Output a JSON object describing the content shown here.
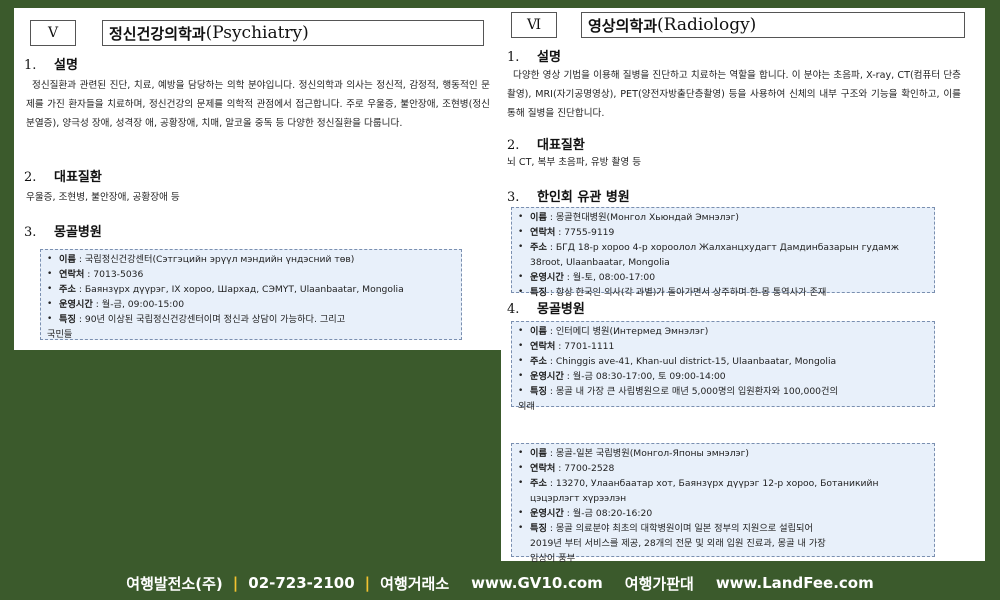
{
  "left": {
    "chapter_num": "Ⅴ",
    "chapter_title_ko": "정신건강의학과",
    "chapter_title_en": "(Psychiatry)",
    "s1": {
      "num": "1.",
      "title": "설명",
      "text": "정신질환과 관련된 진단, 치료, 예방을 담당하는 의학 분야입니다. 정신의학과 의사는 정신적, 감정적, 행동적인 문제를 가진 환자들을 치료하며, 정신건강의 문제를 의학적 관점에서 접근합니다. 주로 우울증, 불안장애, 조현병(정신분열증), 양극성 장애, 성격장 애, 공황장애, 치매, 알코올 중독 등 다양한 정신질환을 다룹니다."
    },
    "s2": {
      "num": "2.",
      "title": "대표질환",
      "text": "우울증, 조현병, 불안장애, 공황장애 등"
    },
    "s3": {
      "num": "3.",
      "title": "몽골병원"
    },
    "hospital": {
      "name_label": "이름",
      "name": "국립정신건강센터(Сэтгэцийн эрүүл мэндийн үндэсний төв)",
      "phone_label": "연락처",
      "phone": "7013-5036",
      "addr_label": "주소",
      "addr": "Баянзүрх дүүрэг, IX хороо, Шархад, СЭМҮТ, Ulaanbaatar, Mongolia",
      "hours_label": "운영시간",
      "hours": "월-금, 09:00-15:00",
      "feat_label": "특징",
      "feat": "90년 이상된 국립정신건강센터이며 정신과 상담이 가능하다. 그리고",
      "feat_cont": "국민들"
    }
  },
  "right": {
    "chapter_num": "Ⅵ",
    "chapter_title_ko": "영상의학과",
    "chapter_title_en": "(Radiology)",
    "s1": {
      "num": "1.",
      "title": "설명",
      "text": "다양한 영상 기법을 이용해 질병을 진단하고 치료하는 역할을 합니다. 이 분야는 초음파, X-ray, CT(컴퓨터 단층촬영), MRI(자기공명영상), PET(양전자방출단층촬영) 등을 사용하여 신체의 내부 구조와 기능을 확인하고, 이를 통해 질병을 진단합니다."
    },
    "s2": {
      "num": "2.",
      "title": "대표질환",
      "text": "뇌 CT, 복부 초음파, 유방 촬영 등"
    },
    "s3": {
      "num": "3.",
      "title": "한인회 유관 병원"
    },
    "korean_hospital": {
      "name_label": "이름",
      "name": "몽골현대병원(Монгол Хьюндай Эмнэлэг)",
      "phone_label": "연락처",
      "phone": "7755-9119",
      "addr_label": "주소",
      "addr": "БГД 18-р хороо 4-р хороолол Жалханцхудагт Дамдинбазарын гудамж",
      "addr_cont": "38root, Ulaanbaatar, Mongolia",
      "hours_label": "운영시간",
      "hours": "월-토, 08:00-17:00",
      "feat_label": "특징",
      "feat": "항상 한국인 의사(각 과별)가 돌아가면서 상주하며 한-몽 통역사가 존재"
    },
    "s4": {
      "num": "4.",
      "title": "몽골병원"
    },
    "hospital1": {
      "name_label": "이름",
      "name": "인터메디 병원(Интермед Эмнэлэг)",
      "phone_label": "연락처",
      "phone": "7701-1111",
      "addr_label": "주소",
      "addr": "Chinggis ave-41, Khan-uul district-15, Ulaanbaatar, Mongolia",
      "hours_label": "운영시간",
      "hours": "월-금 08:30-17:00, 토 09:00-14:00",
      "feat_label": "특징",
      "feat": "몽골 내 가장 큰 사립병원으로 매년 5,000명의 입원환자와 100,000건의",
      "feat_cont": "외래"
    },
    "hospital2": {
      "name_label": "이름",
      "name": "몽골-일본 국립병원(Монгол-Японы эмнэлэг)",
      "phone_label": "연락처",
      "phone": "7700-2528",
      "addr_label": "주소",
      "addr": "13270, Улаанбаатар хот, Баянзүрх дүүрэг 12-р хороо, Ботаникийн",
      "addr_cont": "цэцэрлэгт хүрээлэн",
      "hours_label": "운영시간",
      "hours": "월-금 08:20-16:20",
      "feat_label": "특징",
      "feat": "몽골 의료분야 최초의 대학병원이며 일본 정부의 지원으로 설립되어",
      "feat_cont": "2019년 부터 서비스를 제공, 28개의 전문 및 외래 입원 진료과, 몽골 내 가장",
      "feat_cont2": "임상이 풍부"
    }
  },
  "footer": {
    "company": "여행발전소(주)",
    "phone": "02-723-2100",
    "agency_label": "여행거래소",
    "agency_url": "www.GV10.com",
    "price_label": "여행가판대",
    "price_url": "www.LandFee.com",
    "separator": "|"
  },
  "colors": {
    "background": "#3b5a2c",
    "box": "#e8f0fa",
    "footer_sep": "#f2c230"
  }
}
